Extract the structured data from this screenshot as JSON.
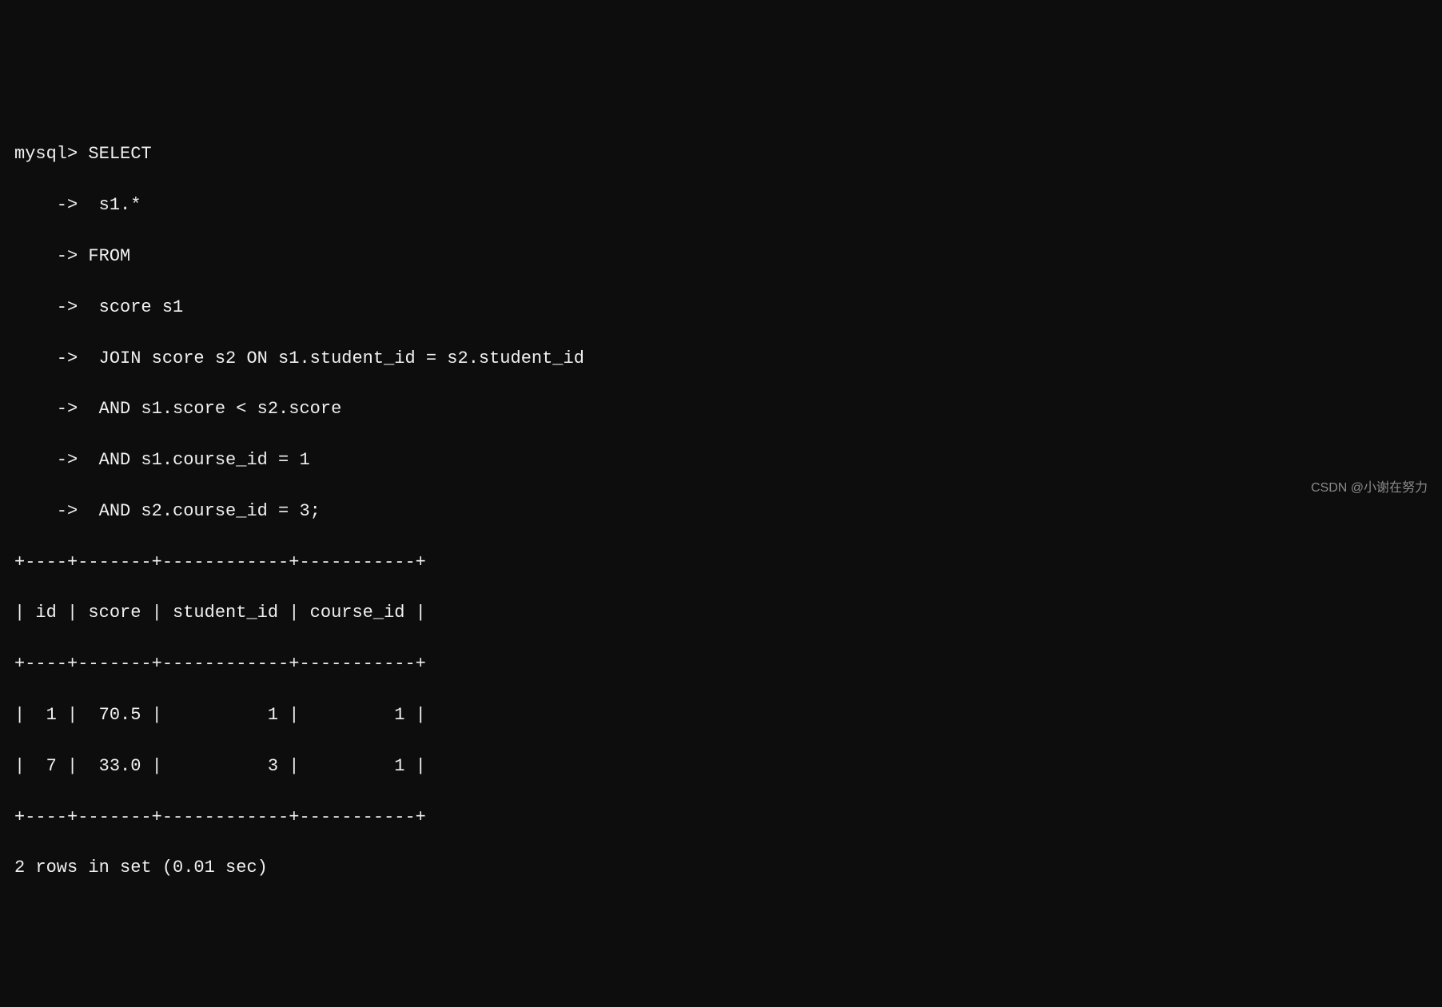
{
  "terminal": {
    "lines": [
      "mysql> SELECT",
      "    ->  s1.*",
      "    -> FROM",
      "    ->  score s1",
      "    ->  JOIN score s2 ON s1.student_id = s2.student_id",
      "    ->  AND s1.score < s2.score",
      "    ->  AND s1.course_id = 1",
      "    ->  AND s2.course_id = 3;",
      "+----+-------+------------+-----------+",
      "| id | score | student_id | course_id |",
      "+----+-------+------------+-----------+",
      "|  1 |  70.5 |          1 |         1 |",
      "|  7 |  33.0 |          3 |         1 |",
      "+----+-------+------------+-----------+",
      "2 rows in set (0.01 sec)"
    ]
  },
  "watermark": "CSDN @小谢在努力",
  "chart_data": {
    "type": "table",
    "title": "mysql query result",
    "columns": [
      "id",
      "score",
      "student_id",
      "course_id"
    ],
    "rows": [
      [
        1,
        70.5,
        1,
        1
      ],
      [
        7,
        33.0,
        3,
        1
      ]
    ],
    "summary": "2 rows in set (0.01 sec)",
    "query": "SELECT s1.* FROM score s1 JOIN score s2 ON s1.student_id = s2.student_id AND s1.score < s2.score AND s1.course_id = 1 AND s2.course_id = 3;"
  }
}
